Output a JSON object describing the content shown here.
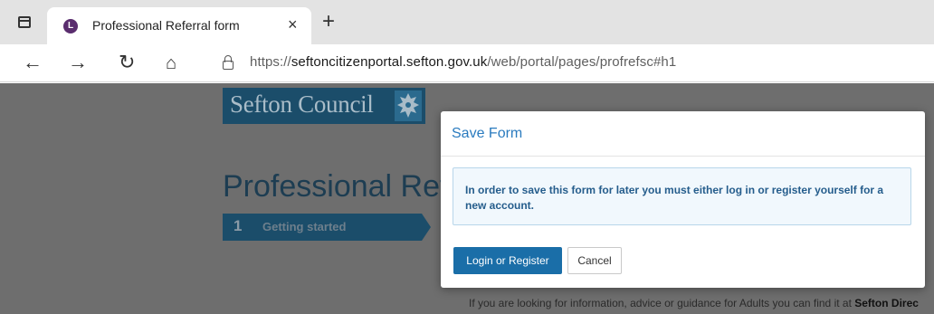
{
  "browser": {
    "tab": {
      "favicon_letter": "L",
      "title": "Professional Referral form",
      "close_glyph": "×"
    },
    "new_tab_glyph": "+",
    "nav": {
      "back_glyph": "←",
      "forward_glyph": "→",
      "reload_glyph": "↻",
      "home_glyph": "⌂"
    },
    "address": {
      "scheme": "https://",
      "host": "seftoncitizenportal.sefton.gov.uk",
      "path": "/web/portal/pages/profrefsc#h1"
    }
  },
  "page": {
    "logo_text": "Sefton Council",
    "heading": "Professional Refe",
    "step": {
      "number": "1",
      "label": "Getting started"
    },
    "footer_prefix": "If you are looking for information, advice or guidance for Adults you can find it at",
    "footer_link": "Sefton Direc"
  },
  "modal": {
    "title": "Save Form",
    "message": "In order to save this form for later you must either log in or register yourself for a new account.",
    "login_button": "Login or Register",
    "cancel_button": "Cancel"
  },
  "colors": {
    "brand_navy": "#1b4d6a",
    "modal_title": "#2a7bbf",
    "primary_button": "#1a6ea8",
    "overlay": "#6e6e6e"
  },
  "icons": [
    "tab-actions-icon",
    "favicon-icon",
    "close-icon",
    "plus-icon",
    "back-arrow-icon",
    "forward-arrow-icon",
    "reload-icon",
    "home-icon",
    "lock-icon",
    "crest-icon"
  ]
}
